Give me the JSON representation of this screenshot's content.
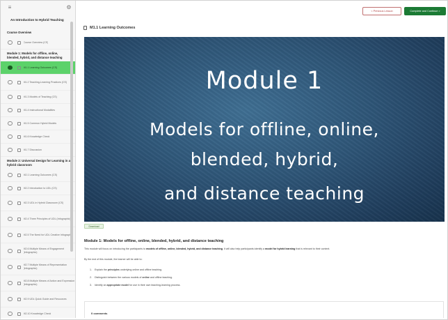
{
  "sidebar": {
    "top_left_icon": "menu-icon",
    "top_right_icon": "gear-icon",
    "course_title": "An Introduction to Hybrid Teaching",
    "section_overview": "Course Overview",
    "overview_item": "Course Overview (CS)",
    "module1_title": "Module 1: Models for offline, online, blended, hybrid, and distance teaching",
    "module1_items": [
      "M1.1 Learning Outcomes (CS)",
      "M1.2 Teaching-Learning Practices (CS)",
      "M1.3 Models of Teaching (CS)",
      "M1.4 Instructional Modalities",
      "M1.5 Common Hybrid Models",
      "M1.6 Knowledge Check",
      "M1.7 Discussion"
    ],
    "module2_title": "Module 2: Universal Design for Learning in a hybrid classroom",
    "module2_items": [
      "M2.1 Learning Outcomes (CS)",
      "M2.2 Introduction to UDL (CS)",
      "M2.3 UDL in Hybrid Classroom (CS)",
      "M2.4 Three Principles of UDL (Infographic)",
      "M2.5 The Need for UDL Creative Infographic",
      "M2.6 Multiple Means of Engagement (infographic)",
      "M2.7 Multiple Means of Representation (infographic)",
      "M2.8 Multiple Means of Action and Expression (infographic)",
      "M2.9 UDL Quick Guide and Resources",
      "M2.10 Knowledge Check",
      "M2.11 Discussion"
    ]
  },
  "topbar": {
    "prev_label": "< Previous Lesson",
    "next_label": "Complete and Continue >"
  },
  "page": {
    "title": "M1.1 Learning Outcomes",
    "hero": {
      "line0": "Module 1",
      "line1": "Models for offline, online,",
      "line2": "blended, hybrid,",
      "line3": "and distance teaching"
    },
    "badge": "Download",
    "heading": "Module 1: Models for offline, online, blended, hybrid, and distance teaching",
    "paragraph_pre": "This module will focus on introducing the participants to ",
    "paragraph_bold1": "models of offline, online, blended, hybrid, and distance teaching",
    "paragraph_mid": ". It will also help participants identify a ",
    "paragraph_bold2": "model for hybrid learning",
    "paragraph_post": " that is relevant to their context.",
    "intro": "By the end of this module, the learner will be able to:",
    "list": [
      {
        "num": "1.",
        "pre": "Explain the ",
        "bold": "principles",
        "post": " underlying online and offline teaching."
      },
      {
        "num": "2.",
        "pre": "Distinguish between the various models of ",
        "bold": "online",
        "post": " and offline teaching."
      },
      {
        "num": "3.",
        "pre": "Identify an ",
        "bold": "appropriate model",
        "post": " for use in their own teaching-learning process."
      }
    ],
    "comments": "0 comments"
  }
}
